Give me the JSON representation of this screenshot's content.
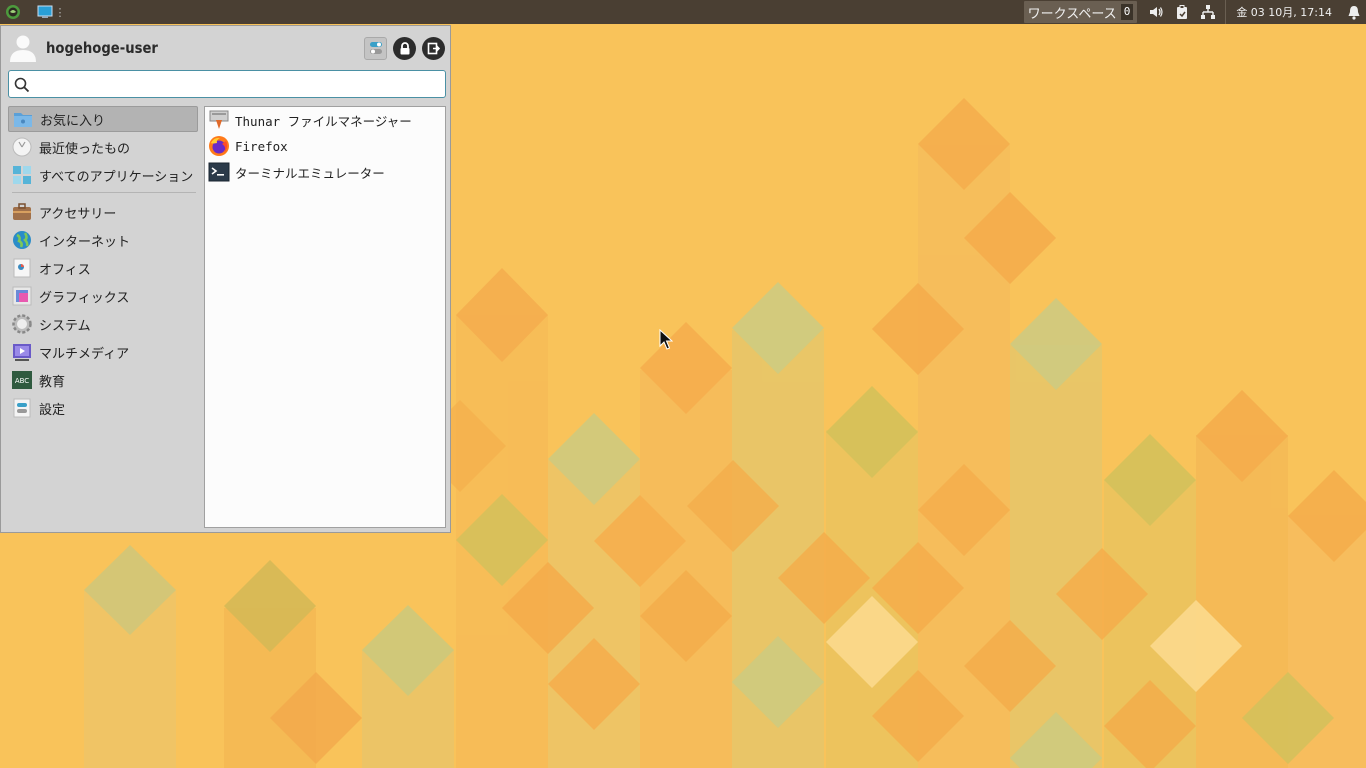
{
  "panel": {
    "workspace_label": "ワークスペース",
    "workspace_number": "0",
    "clock": "金 03 10月, 17:14"
  },
  "menu": {
    "username": "hogehoge-user",
    "search": {
      "value": "",
      "placeholder": ""
    },
    "categories": [
      {
        "label": "お気に入り",
        "icon": "favorites-icon",
        "selected": true
      },
      {
        "label": "最近使ったもの",
        "icon": "recent-icon"
      },
      {
        "label": "すべてのアプリケーション",
        "icon": "all-apps-icon"
      },
      {
        "label": "アクセサリー",
        "icon": "accessories-icon"
      },
      {
        "label": "インターネット",
        "icon": "internet-icon"
      },
      {
        "label": "オフィス",
        "icon": "office-icon"
      },
      {
        "label": "グラフィックス",
        "icon": "graphics-icon"
      },
      {
        "label": "システム",
        "icon": "system-icon"
      },
      {
        "label": "マルチメディア",
        "icon": "multimedia-icon"
      },
      {
        "label": "教育",
        "icon": "education-icon"
      },
      {
        "label": "設定",
        "icon": "settings-icon"
      }
    ],
    "apps": [
      {
        "label": "Thunar ファイルマネージャー",
        "icon": "thunar-icon"
      },
      {
        "label": "Firefox",
        "icon": "firefox-icon"
      },
      {
        "label": "ターミナルエミュレーター",
        "icon": "terminal-icon"
      }
    ]
  },
  "colors": {
    "panel_bg": "#4a3f33",
    "wallpaper_bg": "#f9c35a",
    "menu_bg": "#d3d3d3",
    "selected_bg": "#b3b3b3"
  }
}
